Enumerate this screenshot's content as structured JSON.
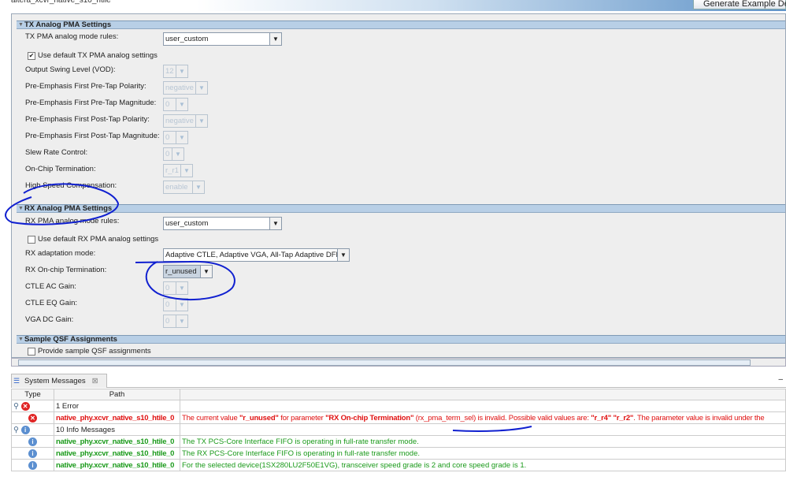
{
  "window": {
    "title": "altera_xcvr_native_s10_htile",
    "generate_button": "Generate Example Design"
  },
  "tx": {
    "header": "TX Analog PMA Settings",
    "mode_rules_label": "TX PMA analog mode rules:",
    "mode_rules_value": "user_custom",
    "use_default_label": "Use default TX PMA analog settings",
    "use_default_checked": true,
    "fields": [
      {
        "label": "Output Swing Level (VOD):",
        "value": "12"
      },
      {
        "label": "Pre-Emphasis First Pre-Tap Polarity:",
        "value": "negative"
      },
      {
        "label": "Pre-Emphasis First Pre-Tap Magnitude:",
        "value": "0"
      },
      {
        "label": "Pre-Emphasis First Post-Tap Polarity:",
        "value": "negative"
      },
      {
        "label": "Pre-Emphasis First Post-Tap Magnitude:",
        "value": "0"
      },
      {
        "label": "Slew Rate Control:",
        "value": "0"
      },
      {
        "label": "On-Chip Termination:",
        "value": "r_r1"
      },
      {
        "label": "High Speed Compensation:",
        "value": "enable"
      }
    ]
  },
  "rx": {
    "header": "RX Analog PMA Settings",
    "mode_rules_label": "RX PMA analog mode rules:",
    "mode_rules_value": "user_custom",
    "use_default_label": "Use default RX PMA analog settings",
    "use_default_checked": false,
    "adaptation_label": "RX adaptation mode:",
    "adaptation_value": "Adaptive CTLE, Adaptive VGA, All-Tap Adaptive DFE",
    "termination_label": "RX On-chip Termination:",
    "termination_value": "r_unused",
    "fields": [
      {
        "label": "CTLE AC Gain:",
        "value": "0"
      },
      {
        "label": "CTLE EQ Gain:",
        "value": "0"
      },
      {
        "label": "VGA DC Gain:",
        "value": "0"
      }
    ]
  },
  "qsf": {
    "header": "Sample QSF Assignments",
    "checkbox_label": "Provide sample QSF assignments"
  },
  "messages": {
    "tab_label": "System Messages",
    "columns": [
      "Type",
      "Path",
      ""
    ],
    "error_group": "1 Error",
    "error": {
      "path": "native_phy.xcvr_native_s10_htile_0",
      "parts": [
        "The current value ",
        "\"r_unused\"",
        " for parameter ",
        "\"RX On-chip Termination\"",
        " (rx_pma_term_sel) is invalid. Possible valid values are: ",
        "\"r_r4\" \"r_r2\"",
        ". The parameter value is invalid under the"
      ]
    },
    "info_group": "10 Info Messages",
    "infos": [
      {
        "path": "native_phy.xcvr_native_s10_htile_0",
        "text": "The TX PCS-Core Interface FIFO is operating in full-rate transfer mode."
      },
      {
        "path": "native_phy.xcvr_native_s10_htile_0",
        "text": "The RX PCS-Core Interface FIFO is operating in full-rate transfer mode."
      },
      {
        "path": "native_phy.xcvr_native_s10_htile_0",
        "text": "For the selected device(1SX280LU2F50E1VG), transceiver speed grade is 2 and core speed grade is 1."
      }
    ]
  }
}
